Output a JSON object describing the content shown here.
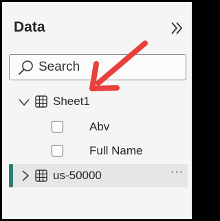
{
  "pane": {
    "title": "Data",
    "collapse_icon": "double-chevron-right-icon"
  },
  "search": {
    "placeholder": "Search",
    "icon": "search-icon"
  },
  "tree": {
    "tables": [
      {
        "name": "Sheet1",
        "expanded": true,
        "fields": [
          {
            "name": "Abv",
            "checked": false
          },
          {
            "name": "Full Name",
            "checked": false
          }
        ]
      },
      {
        "name": "us-50000",
        "expanded": false,
        "selected": true,
        "more_label": "···"
      }
    ]
  },
  "annotation": {
    "arrow_color": "#e8403c"
  },
  "colors": {
    "accent": "#2f7d6d",
    "background": "#f5f5f5"
  }
}
